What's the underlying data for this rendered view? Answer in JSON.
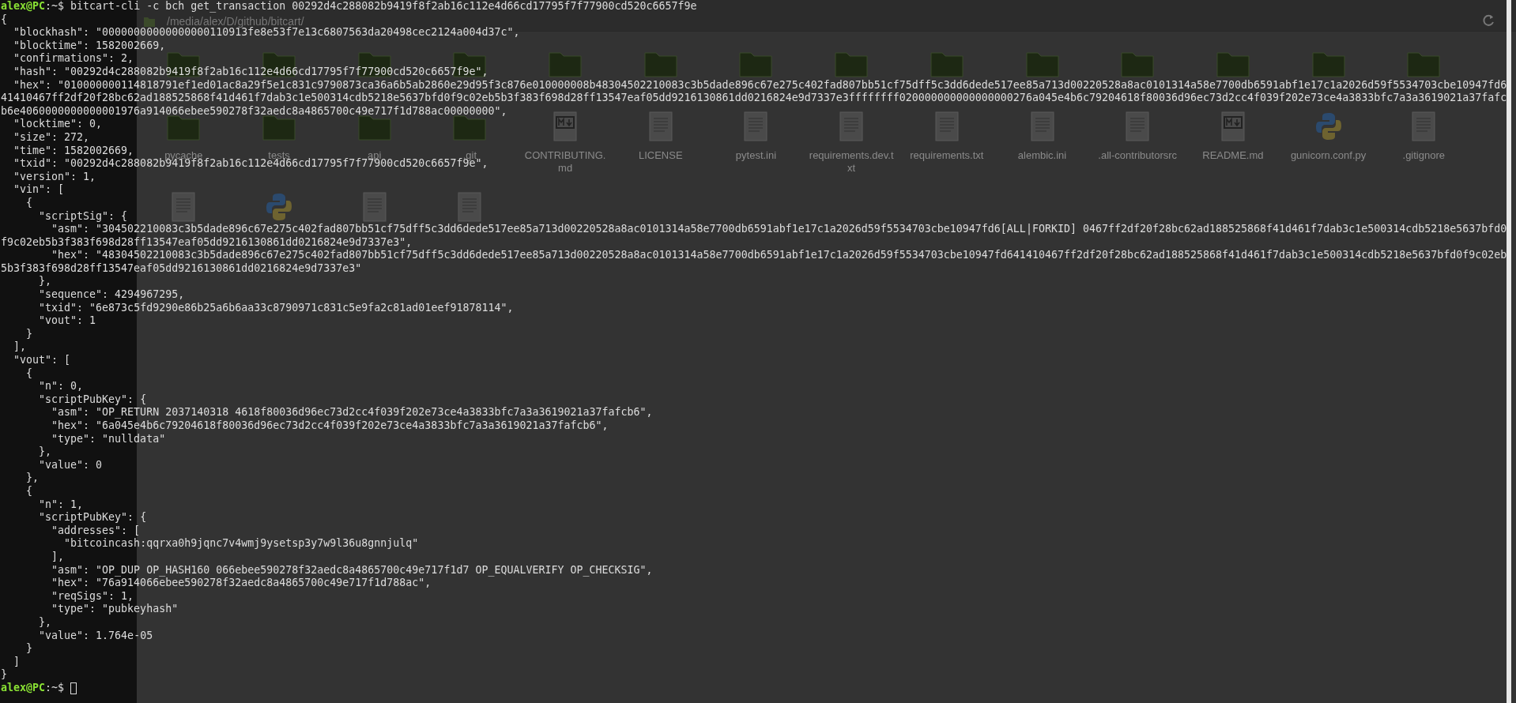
{
  "file_manager": {
    "path": "/media/alex/D/github/bitcart/",
    "rows": [
      {
        "items": [
          {
            "kind": "folder"
          },
          {
            "kind": "folder"
          },
          {
            "kind": "folder"
          },
          {
            "kind": "folder"
          },
          {
            "kind": "folder"
          },
          {
            "kind": "folder"
          },
          {
            "kind": "folder"
          },
          {
            "kind": "folder"
          },
          {
            "kind": "folder"
          },
          {
            "kind": "folder"
          },
          {
            "kind": "folder"
          },
          {
            "kind": "folder"
          },
          {
            "kind": "folder"
          },
          {
            "kind": "folder"
          }
        ]
      },
      {
        "items": [
          {
            "kind": "folder",
            "label": "pycache"
          },
          {
            "kind": "folder",
            "label": "tests"
          },
          {
            "kind": "folder",
            "label": "api"
          },
          {
            "kind": "folder",
            "label": ".git"
          },
          {
            "kind": "markdown",
            "label": "CONTRIBUTING.md"
          },
          {
            "kind": "document",
            "label": "LICENSE"
          },
          {
            "kind": "document",
            "label": "pytest.ini"
          },
          {
            "kind": "document",
            "label": "requirements.dev.txt"
          },
          {
            "kind": "document",
            "label": "requirements.txt"
          },
          {
            "kind": "document",
            "label": "alembic.ini"
          },
          {
            "kind": "document",
            "label": ".all-contributorsrc"
          },
          {
            "kind": "markdown",
            "label": "README.md"
          },
          {
            "kind": "python",
            "label": "gunicorn.conf.py"
          },
          {
            "kind": "document",
            "label": ".gitignore"
          }
        ]
      },
      {
        "items": [
          {
            "kind": "document"
          },
          {
            "kind": "python"
          },
          {
            "kind": "document"
          },
          {
            "kind": "document"
          }
        ]
      }
    ]
  },
  "terminal": {
    "prompt_user": "alex@PC",
    "prompt_path": ":~$",
    "command": "bitcart-cli -c bch get_transaction 00292d4c288082b9419f8f2ab16c112e4d66cd17795f7f77900cd520c6657f9e",
    "output": [
      "{",
      "  \"blockhash\": \"00000000000000000110913fe8e53f7e13c6807563da20498cec2124a004d37c\",",
      "  \"blocktime\": 1582002669,",
      "  \"confirmations\": 2,",
      "  \"hash\": \"00292d4c288082b9419f8f2ab16c112e4d66cd17795f7f77900cd520c6657f9e\",",
      "  \"hex\": \"010000000114818791ef1ed01ac8a29f5e1c831c9790873ca36a6b5ab2860e29d95f3c876e010000008b48304502210083c3b5dade896c67e275c402fad807bb51cf75dff5c3dd6dede517ee85a713d00220528a8ac0101314a58e7700db6591abf1e17c1a2026d59f5534703cbe10947fd641410467ff2df20f28bc62ad188525868f41d461f7dab3c1e500314cdb5218e5637bfd0f9c02eb5b3f383f698d28ff13547eaf05dd9216130861dd0216824e9d7337e3ffffffff020000000000000000276a045e4b6c79204618f80036d96ec73d2cc4f039f202e73ce4a3833bfc7a3a3619021a37fafcb6e4060000000000001976a914066ebee590278f32aedc8a4865700c49e717f1d788ac00000000\",",
      "  \"locktime\": 0,",
      "  \"size\": 272,",
      "  \"time\": 1582002669,",
      "  \"txid\": \"00292d4c288082b9419f8f2ab16c112e4d66cd17795f7f77900cd520c6657f9e\",",
      "  \"version\": 1,",
      "  \"vin\": [",
      "    {",
      "      \"scriptSig\": {",
      "        \"asm\": \"304502210083c3b5dade896c67e275c402fad807bb51cf75dff5c3dd6dede517ee85a713d00220528a8ac0101314a58e7700db6591abf1e17c1a2026d59f5534703cbe10947fd6[ALL|FORKID] 0467ff2df20f28bc62ad188525868f41d461f7dab3c1e500314cdb5218e5637bfd0f9c02eb5b3f383f698d28ff13547eaf05dd9216130861dd0216824e9d7337e3\",",
      "        \"hex\": \"48304502210083c3b5dade896c67e275c402fad807bb51cf75dff5c3dd6dede517ee85a713d00220528a8ac0101314a58e7700db6591abf1e17c1a2026d59f5534703cbe10947fd641410467ff2df20f28bc62ad188525868f41d461f7dab3c1e500314cdb5218e5637bfd0f9c02eb5b3f383f698d28ff13547eaf05dd9216130861dd0216824e9d7337e3\"",
      "      },",
      "      \"sequence\": 4294967295,",
      "      \"txid\": \"6e873c5fd9290e86b25a6b6aa33c8790971c831c5e9fa2c81ad01eef91878114\",",
      "      \"vout\": 1",
      "    }",
      "  ],",
      "  \"vout\": [",
      "    {",
      "      \"n\": 0,",
      "      \"scriptPubKey\": {",
      "        \"asm\": \"OP_RETURN 2037140318 4618f80036d96ec73d2cc4f039f202e73ce4a3833bfc7a3a3619021a37fafcb6\",",
      "        \"hex\": \"6a045e4b6c79204618f80036d96ec73d2cc4f039f202e73ce4a3833bfc7a3a3619021a37fafcb6\",",
      "        \"type\": \"nulldata\"",
      "      },",
      "      \"value\": 0",
      "    },",
      "    {",
      "      \"n\": 1,",
      "      \"scriptPubKey\": {",
      "        \"addresses\": [",
      "          \"bitcoincash:qqrxa0h9jqnc7v4wmj9ysetsp3y7w9l36u8gnnjulq\"",
      "        ],",
      "        \"asm\": \"OP_DUP OP_HASH160 066ebee590278f32aedc8a4865700c49e717f1d7 OP_EQUALVERIFY OP_CHECKSIG\",",
      "        \"hex\": \"76a914066ebee590278f32aedc8a4865700c49e717f1d788ac\",",
      "        \"reqSigs\": 1,",
      "        \"type\": \"pubkeyhash\"",
      "      },",
      "      \"value\": 1.764e-05",
      "    }",
      "  ]",
      "}"
    ],
    "final_prompt": {
      "user": "alex@PC",
      "path": ":~$"
    }
  }
}
